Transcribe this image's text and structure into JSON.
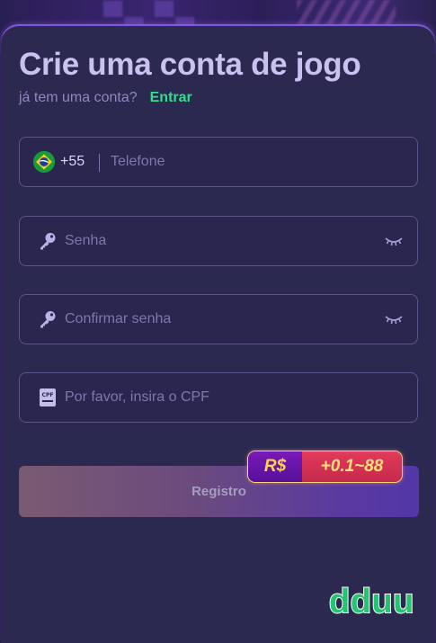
{
  "header": {
    "title": "Crie uma conta de jogo",
    "have_account_text": "já tem uma conta?",
    "login_link": "Entrar"
  },
  "form": {
    "phone": {
      "country_code": "+55",
      "placeholder": "Telefone",
      "flag_icon": "brazil-flag-icon"
    },
    "password": {
      "placeholder": "Senha",
      "icon": "key-icon",
      "toggle_icon": "eye-closed-icon"
    },
    "confirm_password": {
      "placeholder": "Confirmar senha",
      "icon": "key-icon",
      "toggle_icon": "eye-closed-icon"
    },
    "cpf": {
      "placeholder": "Por favor, insira o CPF",
      "icon": "cpf-card-icon",
      "icon_text": "CPF"
    }
  },
  "submit": {
    "label": "Registro",
    "bonus": {
      "currency": "R$",
      "amount": "+0.1~88"
    }
  },
  "brand": {
    "logo_text": "dduu"
  },
  "colors": {
    "accent_green": "#2fdf8a",
    "panel_bg": "#2c2950",
    "title": "#c9c2f0"
  }
}
